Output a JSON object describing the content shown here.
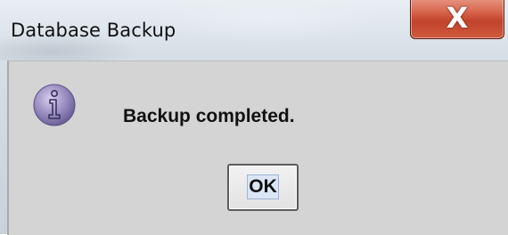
{
  "window": {
    "title": "Database Backup",
    "close_glyph": "X"
  },
  "dialog": {
    "icon": "info-icon",
    "message": "Backup completed.",
    "ok_label": "OK"
  },
  "colors": {
    "close_button": "#c9452c",
    "dialog_background": "#d4d4d4",
    "icon_purple": "#8c7fb3"
  }
}
